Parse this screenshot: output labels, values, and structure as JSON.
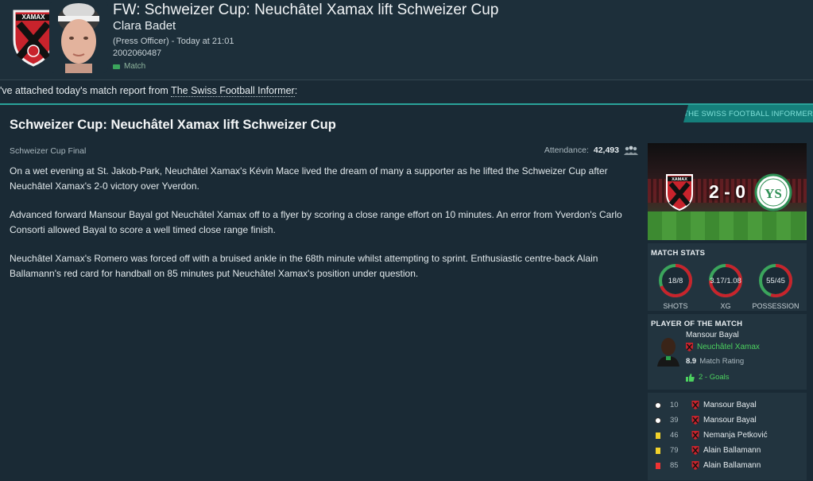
{
  "header": {
    "title": "FW: Schweizer Cup: Neuchâtel Xamax lift Schweizer Cup",
    "sender": "Clara Badet",
    "role_time": "(Press Officer) - Today at 21:01",
    "message_id": "2002060487",
    "tag": "Match",
    "club_badge_text": "XAMAX"
  },
  "intro": {
    "prefix": "'ve attached today's match report from ",
    "source": "The Swiss Football Informer",
    "suffix": ":"
  },
  "report": {
    "paper_tab": "THE SWISS FOOTBALL INFORMER",
    "headline": "Schweizer Cup: Neuchâtel Xamax lift Schweizer Cup",
    "competition": "Schweizer Cup Final",
    "attendance_label": "Attendance:",
    "attendance_value": "42,493",
    "paragraphs": [
      "On a wet evening at St. Jakob-Park, Neuchâtel Xamax's Kévin Mace lived the dream of many a supporter as he lifted the Schweizer Cup after Neuchâtel Xamax's 2-0 victory over Yverdon.",
      "Advanced forward Mansour Bayal got Neuchâtel Xamax off to a flyer by scoring a close range effort on 10 minutes. An error from Yverdon's Carlo Consorti allowed Bayal to score a well timed close range finish.",
      "Neuchâtel Xamax's Romero was forced off with a bruised ankle in the 68th minute whilst attempting to sprint. Enthusiastic centre-back Alain Ballamann's red card for handball on 85 minutes put Neuchâtel Xamax's position under question."
    ]
  },
  "scoreboard": {
    "score": "2 - 0",
    "home_badge_text": "XAMAX",
    "away_badge_text": "YS"
  },
  "match_stats": {
    "title": "MATCH STATS",
    "items": [
      {
        "value": "18/8",
        "label": "SHOTS",
        "home_share": 0.69
      },
      {
        "value": "3.17/1.08",
        "label": "XG",
        "home_share": 0.75
      },
      {
        "value": "55/45",
        "label": "POSSESSION",
        "home_share": 0.55
      }
    ],
    "colors": {
      "home": "#c8232c",
      "away": "#3ba55c"
    }
  },
  "potm": {
    "title": "PLAYER OF THE MATCH",
    "name": "Mansour Bayal",
    "club": "Neuchâtel Xamax",
    "rating": "8.9",
    "rating_label": "Match Rating",
    "goals": "2 - Goals"
  },
  "events": [
    {
      "type": "goal",
      "minute": "10",
      "player": "Mansour Bayal"
    },
    {
      "type": "goal",
      "minute": "39",
      "player": "Mansour Bayal"
    },
    {
      "type": "yellow",
      "minute": "46",
      "player": "Nemanja Petković"
    },
    {
      "type": "yellow",
      "minute": "79",
      "player": "Alain Ballamann"
    },
    {
      "type": "red",
      "minute": "85",
      "player": "Alain Ballamann"
    }
  ]
}
